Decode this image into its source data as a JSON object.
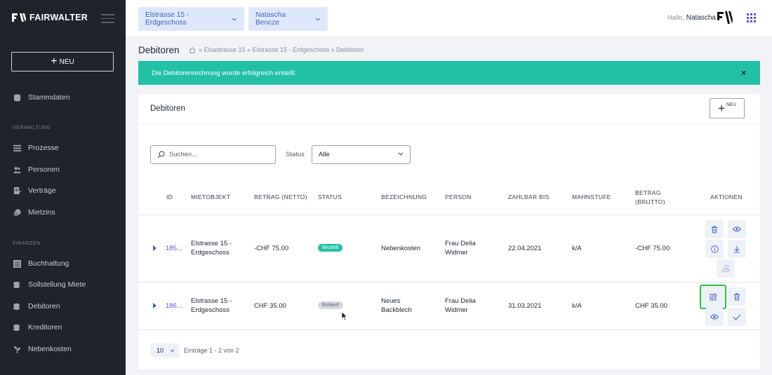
{
  "app": {
    "brand": "FAIRWALTER"
  },
  "sidebar": {
    "new_label": "NEU",
    "items_top": [
      {
        "label": "Stammdaten",
        "icon": "database-icon"
      }
    ],
    "section_verwaltung": "VERWALTUNG",
    "items_verwaltung": [
      {
        "label": "Prozesse",
        "icon": "list-icon"
      },
      {
        "label": "Personen",
        "icon": "people-icon"
      },
      {
        "label": "Verträge",
        "icon": "contract-icon"
      },
      {
        "label": "Mietzins",
        "icon": "coins-icon"
      }
    ],
    "section_finanzen": "FINANZEN",
    "items_finanzen": [
      {
        "label": "Buchhaltung",
        "icon": "ledger-icon"
      },
      {
        "label": "Sollstellung Miete",
        "icon": "coins-icon"
      },
      {
        "label": "Debitoren",
        "icon": "coins-icon"
      },
      {
        "label": "Kreditoren",
        "icon": "coins-icon"
      },
      {
        "label": "Nebenkosten",
        "icon": "plant-icon"
      }
    ]
  },
  "topbar": {
    "property_select": "Elstrasse 15 - Erdgeschoss",
    "person_select": "Natascha Bencze",
    "greeting_prefix": "Hallo,",
    "greeting_name": "Natascha"
  },
  "page": {
    "title": "Debitoren",
    "breadcrumb": "» Elsastrasse 15 » Elstrasse 15 - Erdgeschoss » Debitoren"
  },
  "alert": {
    "message": "Die Debitorenrechnung wurde erfolgreich erstellt.",
    "close": "×"
  },
  "card": {
    "title": "Debitoren",
    "new_label": "NEU",
    "search_placeholder": "Suchen...",
    "status_label": "Status",
    "status_value": "Alle"
  },
  "table": {
    "headers": {
      "id": "ID",
      "mietobjekt": "MIETOBJEKT",
      "netto": "BETRAG (NETTO)",
      "status": "STATUS",
      "bezeichnung": "BEZEICHNUNG",
      "person": "PERSON",
      "zahlbar": "ZAHLBAR BIS",
      "mahnstufe": "MAHNSTUFE",
      "brutto_1": "BETRAG",
      "brutto_2": "(BRUTTO)",
      "aktionen": "AKTIONEN"
    },
    "rows": [
      {
        "id": "185...",
        "mietobjekt_1": "Elstrasse 15 -",
        "mietobjekt_2": "Erdgeschoss",
        "netto": "-CHF 75.00",
        "status": "Bezahlt",
        "bezeichnung_1": "Nebenkosten",
        "bezeichnung_2": "",
        "person_1": "Frau Delia",
        "person_2": "Widmer",
        "zahlbar": "22.04.2021",
        "mahnstufe": "k/A",
        "brutto": "-CHF 75.00"
      },
      {
        "id": "186...",
        "mietobjekt_1": "Elstrasse 15 -",
        "mietobjekt_2": "Erdgeschoss",
        "netto": "CHF 35.00",
        "status": "Entwurf",
        "bezeichnung_1": "Neues",
        "bezeichnung_2": "Backblech",
        "person_1": "Frau Delia",
        "person_2": "Widmer",
        "zahlbar": "31.03.2021",
        "mahnstufe": "k/A",
        "brutto": "CHF 35.00"
      }
    ]
  },
  "pagination": {
    "page_size": "10",
    "entries": "Einträge 1 - 2 von 2"
  },
  "colors": {
    "accent": "#4a58d8",
    "success": "#22c1a6",
    "sidebar": "#1f232b",
    "highlight": "#27c43d"
  }
}
